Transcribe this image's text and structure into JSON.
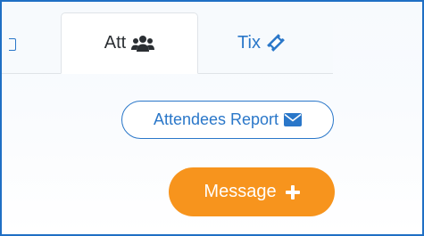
{
  "tabs": {
    "partial_icon": "calendar-icon",
    "att": {
      "label": "Att",
      "icon": "users-icon",
      "active": true
    },
    "tix": {
      "label": "Tix",
      "icon": "ticket-icon",
      "active": false
    }
  },
  "actions": {
    "report": {
      "label": "Attendees Report",
      "icon": "envelope-icon"
    },
    "message": {
      "label": "Message",
      "icon": "plus-icon"
    }
  },
  "colors": {
    "primary": "#2a77c9",
    "accent": "#f7941d",
    "frame_border": "#1f6fc4"
  }
}
